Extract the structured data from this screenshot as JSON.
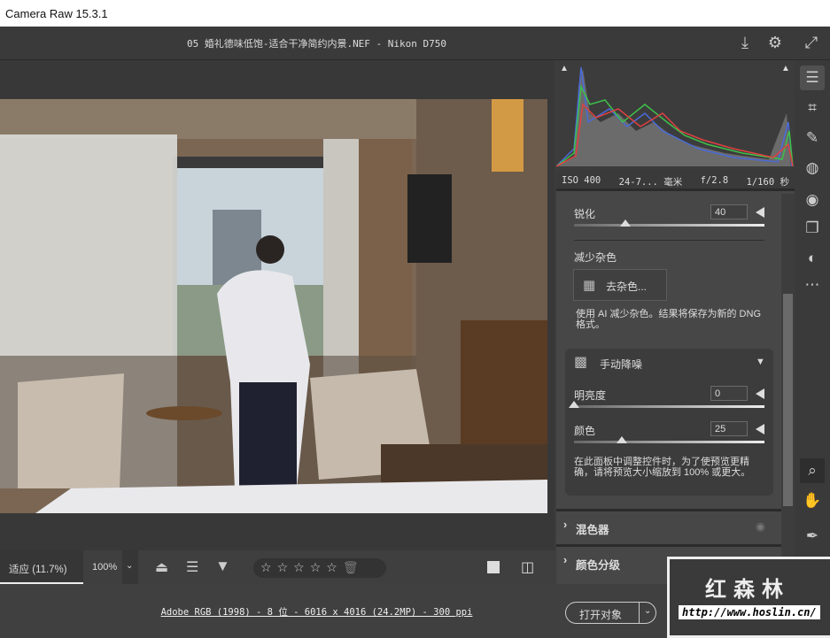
{
  "app_title": "Camera Raw 15.3.1",
  "header": {
    "file_title": "05 婚礼德味低饱-适合干净简约内景.NEF -  Nikon D750"
  },
  "exif": {
    "iso": "ISO 400",
    "focal": "24-7... 毫米",
    "aperture": "f/2.8",
    "shutter": "1/160 秒"
  },
  "detail": {
    "sharpen_label": "锐化",
    "sharpen_value": "40",
    "sharpen_pct": 0.27,
    "noise_heading": "减少杂色",
    "denoise_button": "去杂色...",
    "denoise_note": "使用 AI 减少杂色。结果将保存为新的 DNG 格式。",
    "manual_heading": "手动降噪",
    "luminance_label": "明亮度",
    "luminance_value": "0",
    "luminance_pct": 0,
    "color_label": "颜色",
    "color_value": "25",
    "color_pct": 0.25,
    "preview_note": "在此面板中调整控件时，为了使预览更精确，请将预览大小缩放到 100% 或更大。"
  },
  "sections": [
    {
      "label": "混色器"
    },
    {
      "label": "颜色分级"
    }
  ],
  "toolbar": {
    "fit_tab": "适应 (11.7%)",
    "zoom_100": "100%",
    "rating_stars": 0
  },
  "status": {
    "info_link": "Adobe RGB (1998) - 8 位 - 6016 x 4016 (24.2MP) - 300 ppi",
    "open_button": "打开对象"
  },
  "watermark": {
    "name": "红森林",
    "url": "http://www.hoslin.cn/"
  }
}
